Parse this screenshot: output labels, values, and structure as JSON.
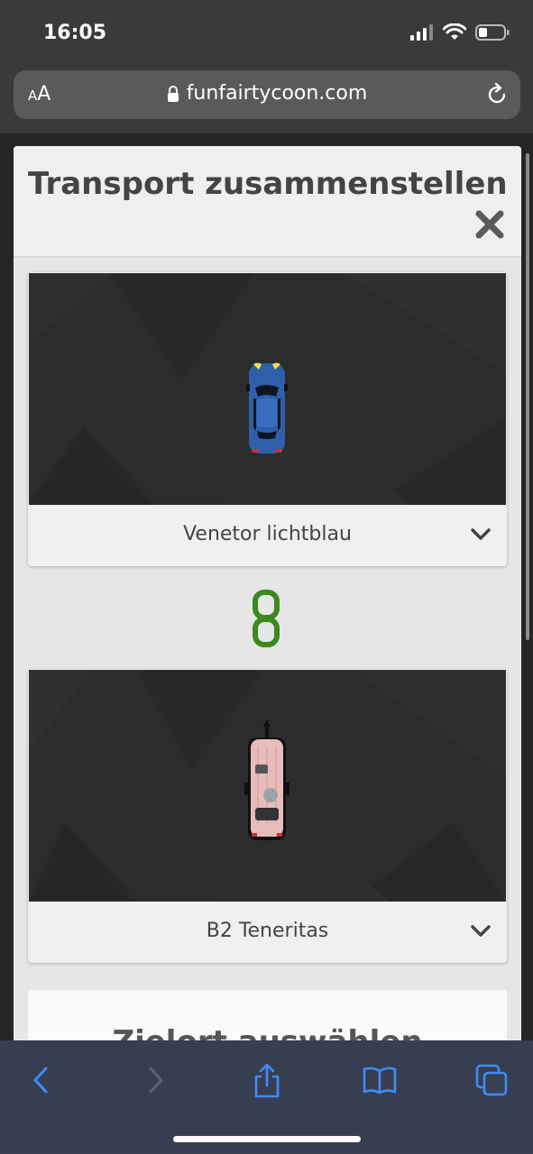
{
  "status": {
    "time": "16:05"
  },
  "browser": {
    "text_size": "AA",
    "url": "funfairtycoon.com"
  },
  "modal": {
    "title": "Transport zusammenstellen"
  },
  "vehicles": [
    {
      "label": "Venetor lichtblau"
    },
    {
      "label": "B2 Teneritas"
    }
  ],
  "next_section": {
    "title": "Zielort auswählen"
  },
  "colors": {
    "link_green": "#3a8a1e",
    "car_blue": "#2f5fa8",
    "trailer_pink": "#e9bcbc"
  }
}
